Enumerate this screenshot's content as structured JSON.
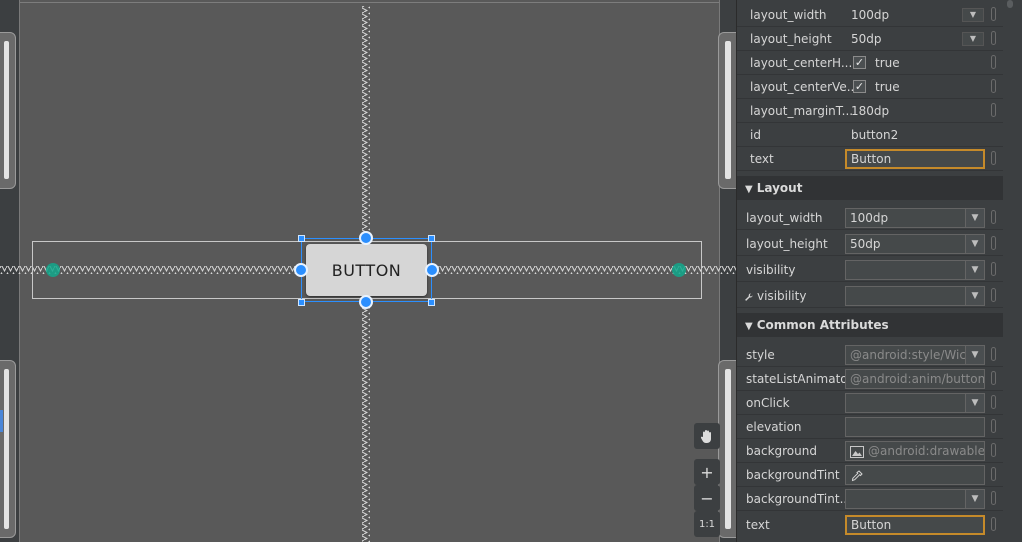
{
  "canvas": {
    "widget_label": "BUTTON",
    "tools": {
      "pan_icon": "hand-icon",
      "zoom_in": "+",
      "zoom_out": "−",
      "actual_size": "1:1"
    }
  },
  "top_attributes": [
    {
      "label": "layout_width",
      "value": "100dp",
      "kind": "combo"
    },
    {
      "label": "layout_height",
      "value": "50dp",
      "kind": "combo"
    },
    {
      "label": "layout_centerH...",
      "value": "true",
      "kind": "check"
    },
    {
      "label": "layout_centerVe...",
      "value": "true",
      "kind": "check"
    },
    {
      "label": "layout_marginT...",
      "value": "180dp",
      "kind": "text"
    },
    {
      "label": "id",
      "value": "button2",
      "kind": "text"
    },
    {
      "label": "text",
      "value": "Button",
      "kind": "input"
    }
  ],
  "layout_section": {
    "title": "Layout",
    "rows": [
      {
        "label": "layout_width",
        "value": "100dp"
      },
      {
        "label": "layout_height",
        "value": "50dp"
      },
      {
        "label": "visibility",
        "value": ""
      },
      {
        "label": "visibility",
        "value": "",
        "icon": "wrench-icon"
      }
    ]
  },
  "common_section": {
    "title": "Common Attributes",
    "rows": [
      {
        "label": "style",
        "placeholder": "@android:style/Wic",
        "kind": "combo"
      },
      {
        "label": "stateListAnimator",
        "placeholder": "@android:anim/button_s",
        "kind": "input"
      },
      {
        "label": "onClick",
        "value": "",
        "kind": "combo"
      },
      {
        "label": "elevation",
        "value": "",
        "kind": "input"
      },
      {
        "label": "background",
        "placeholder": "@android:drawable/b",
        "kind": "input",
        "icon": "image-icon"
      },
      {
        "label": "backgroundTint",
        "value": "",
        "kind": "input",
        "icon": "eyedropper-icon"
      },
      {
        "label": "backgroundTint...",
        "value": "",
        "kind": "combo"
      },
      {
        "label": "text",
        "value": "Button",
        "kind": "input-focused"
      }
    ]
  },
  "colors": {
    "selection": "#2b8fff",
    "anchor": "#12a88c",
    "focus": "#c58a2a"
  }
}
